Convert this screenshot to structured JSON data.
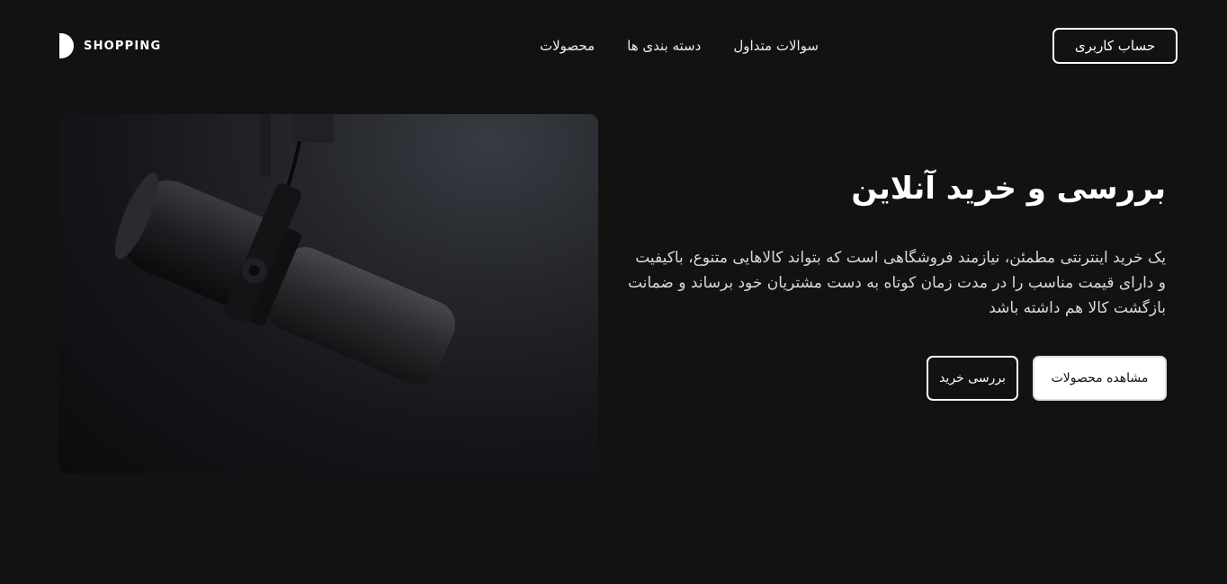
{
  "brand": {
    "name": "SHOPPING",
    "logo_icon": "half-circle-logo-icon"
  },
  "nav": {
    "items": [
      {
        "label": "محصولات"
      },
      {
        "label": "دسته بندی ها"
      },
      {
        "label": "سوالات متداول"
      }
    ],
    "account_label": "حساب کاربری"
  },
  "hero": {
    "title": "بررسی و خرید آنلاین",
    "description": "یک خرید اینترنتی مطمئن، نیازمند فروشگاهی است که بتواند کالاهایی متنوع، باکیفیت و دارای قیمت مناسب را در مدت زمان کوتاه به دست مشتریان خود برساند و ضمانت بازگشت کالا هم داشته باشد",
    "primary_button": "مشاهده محصولات",
    "secondary_button": "بررسی خرید",
    "image": "studio-microphone-image"
  },
  "colors": {
    "background": "#121212",
    "text": "#ffffff",
    "primary_button_bg": "#ffffff"
  }
}
